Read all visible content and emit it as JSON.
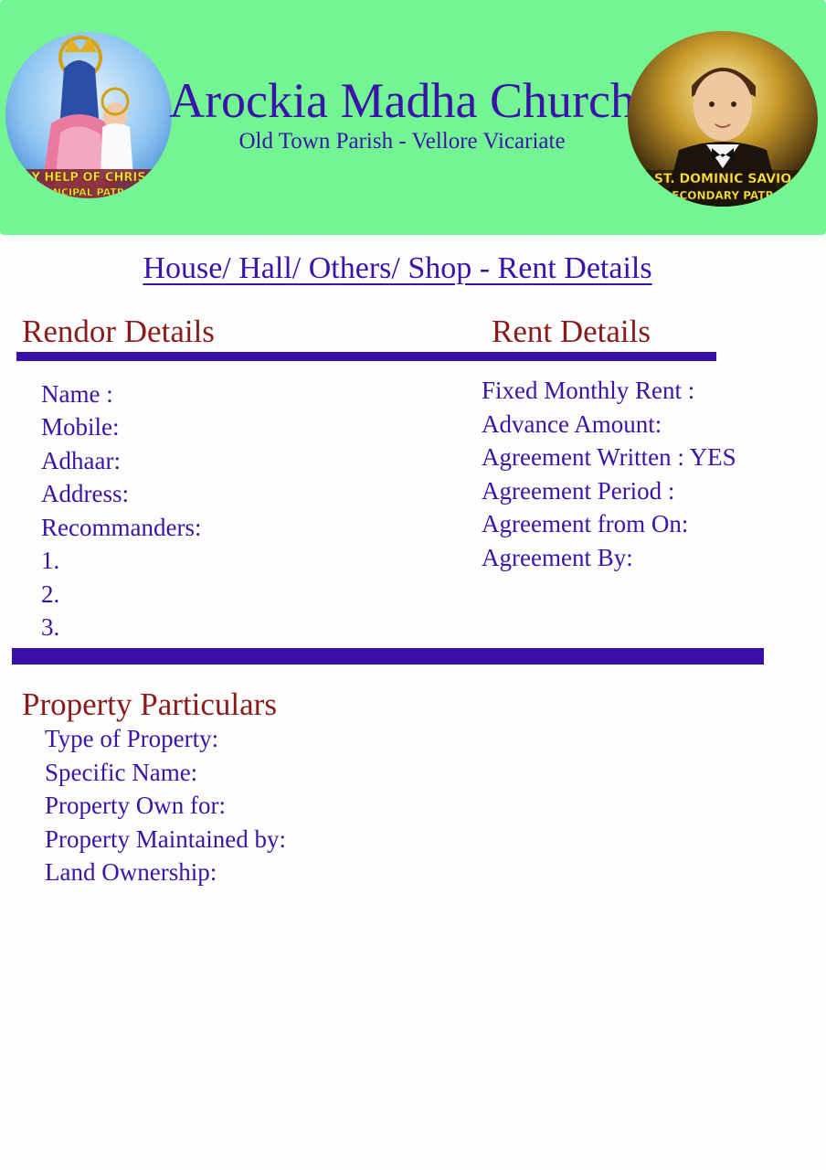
{
  "header": {
    "church_name": "Arockia Madha Church",
    "subtitle": "Old Town Parish - Vellore Vicariate",
    "background_color": "#74f594",
    "left_logo": {
      "text_line1": "Y HELP OF CHRIS",
      "text_line2": "NCIPAL PATR"
    },
    "right_logo": {
      "text_line1": "ST. DOMINIC SAVIO",
      "text_line2": "ECONDARY PATR"
    }
  },
  "document_title": "House/ Hall/ Others/ Shop - Rent Details",
  "rendor_details": {
    "heading": "Rendor Details",
    "fields": [
      "Name :",
      "Mobile:",
      "Adhaar:",
      "Address:",
      "Recommanders:",
      "1.",
      "2.",
      "3."
    ]
  },
  "rent_details": {
    "heading": "Rent Details",
    "fields": [
      "Fixed Monthly Rent :",
      "Advance Amount:",
      "Agreement Written : YES",
      "Agreement Period :",
      "Agreement from On:",
      "Agreement By:"
    ]
  },
  "property_particulars": {
    "heading": "Property Particulars",
    "fields": [
      "Type of Property:",
      "Specific Name:",
      "Property Own for:",
      "Property Maintained by:",
      "Land Ownership:"
    ]
  },
  "colors": {
    "title_blue": "#3a14a8",
    "heading_red": "#8b1a1a",
    "bar_purple": "#3a0fa8"
  }
}
